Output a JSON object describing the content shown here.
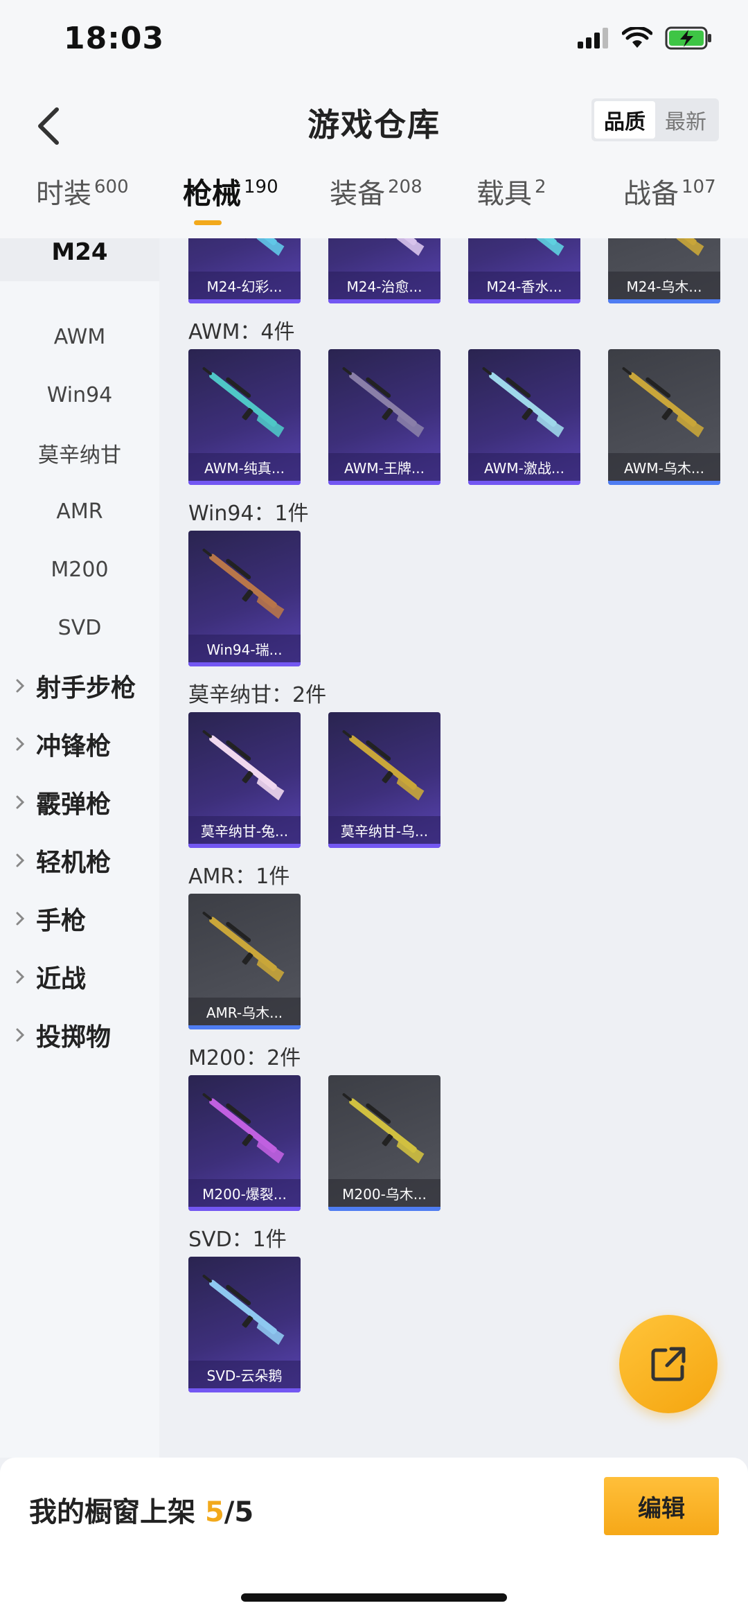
{
  "status": {
    "time": "18:03"
  },
  "header": {
    "title": "游戏仓库",
    "sort": {
      "options": [
        "品质",
        "最新"
      ],
      "selected": "品质"
    }
  },
  "tabs": [
    {
      "label": "时装",
      "count": "600",
      "active": false
    },
    {
      "label": "枪械",
      "count": "190",
      "active": true
    },
    {
      "label": "装备",
      "count": "208",
      "active": false
    },
    {
      "label": "载具",
      "count": "2",
      "active": false
    },
    {
      "label": "战备",
      "count": "107",
      "active": false
    }
  ],
  "sidebar": {
    "selected": "M24",
    "subitems": [
      "AWM",
      "Win94",
      "莫辛纳甘",
      "AMR",
      "M200",
      "SVD"
    ],
    "groups": [
      "射手步枪",
      "冲锋枪",
      "霰弹枪",
      "轻机枪",
      "手枪",
      "近战",
      "投掷物"
    ]
  },
  "sections": [
    {
      "title": "",
      "items": [
        {
          "label": "M24-幻彩...",
          "quality": "purple",
          "gun_color": "#62c8e8"
        },
        {
          "label": "M24-治愈...",
          "quality": "purple",
          "gun_color": "#d8c4ec"
        },
        {
          "label": "M24-香水...",
          "quality": "purple",
          "gun_color": "#5fd0e0"
        },
        {
          "label": "M24-乌木...",
          "quality": "grey",
          "gun_color": "#c9a63a"
        }
      ]
    },
    {
      "title": "AWM：4件",
      "items": [
        {
          "label": "AWM-纯真...",
          "quality": "purple",
          "gun_color": "#4fc7c7"
        },
        {
          "label": "AWM-王牌...",
          "quality": "purple",
          "gun_color": "#8a7fa8"
        },
        {
          "label": "AWM-激战...",
          "quality": "purple",
          "gun_color": "#9fd8ea"
        },
        {
          "label": "AWM-乌木...",
          "quality": "grey",
          "gun_color": "#c9a63a"
        }
      ]
    },
    {
      "title": "Win94：1件",
      "items": [
        {
          "label": "Win94-瑞...",
          "quality": "purple",
          "gun_color": "#b8764a"
        }
      ]
    },
    {
      "title": "莫辛纳甘：2件",
      "items": [
        {
          "label": "莫辛纳甘-兔...",
          "quality": "purple",
          "gun_color": "#f0d8ee"
        },
        {
          "label": "莫辛纳甘-乌...",
          "quality": "purple",
          "gun_color": "#c9a63a"
        }
      ]
    },
    {
      "title": "AMR：1件",
      "items": [
        {
          "label": "AMR-乌木...",
          "quality": "grey",
          "gun_color": "#c9a63a"
        }
      ]
    },
    {
      "title": "M200：2件",
      "items": [
        {
          "label": "M200-爆裂...",
          "quality": "purple",
          "gun_color": "#c060e0"
        },
        {
          "label": "M200-乌木...",
          "quality": "grey",
          "gun_color": "#d0c040"
        }
      ]
    },
    {
      "title": "SVD：1件",
      "items": [
        {
          "label": "SVD-云朵鹅",
          "quality": "purple",
          "gun_color": "#8ec8f0"
        }
      ]
    }
  ],
  "bottom": {
    "shelf_label": "我的橱窗上架",
    "shelf_count": "5",
    "shelf_total": "/5",
    "edit_label": "编辑"
  },
  "colors": {
    "accent": "#f2a91c",
    "purple_card": "#3d2f7a",
    "grey_card": "#4b4d55"
  }
}
